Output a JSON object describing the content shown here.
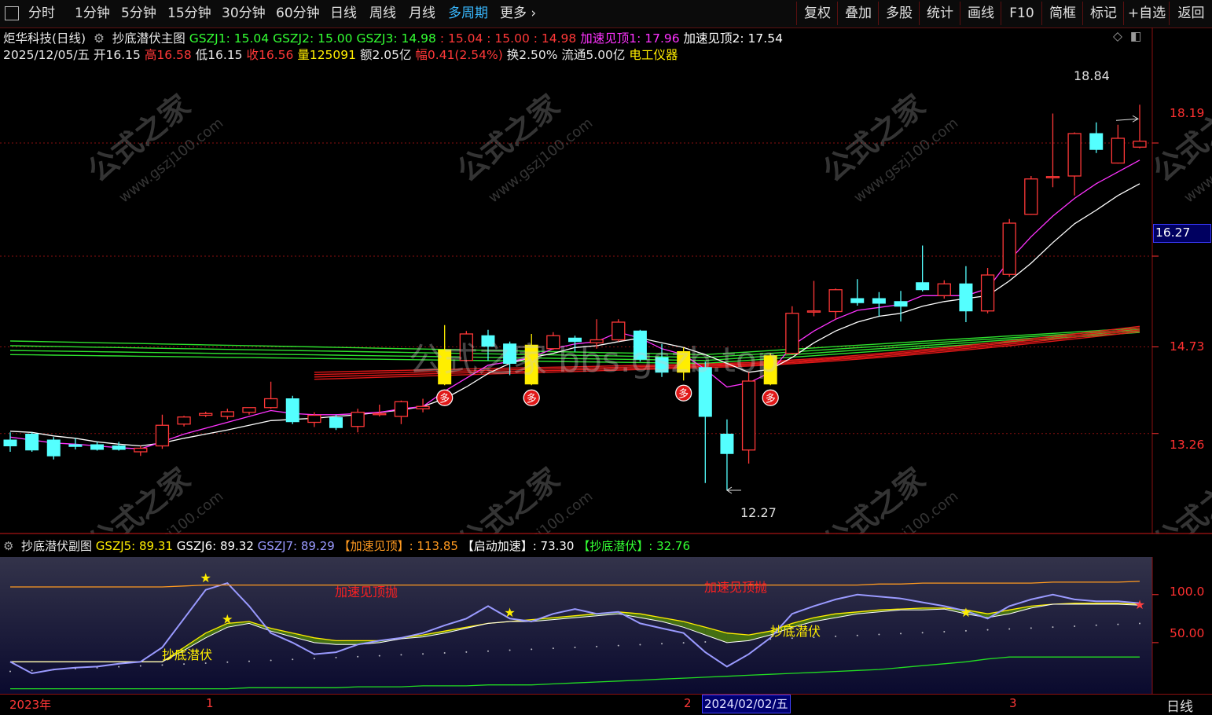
{
  "toolbar": {
    "periods": [
      "分时",
      "1分钟",
      "5分钟",
      "15分钟",
      "30分钟",
      "60分钟",
      "日线",
      "周线",
      "月线",
      "多周期",
      "更多"
    ],
    "active_period": "多周期",
    "actions": [
      "复权",
      "叠加",
      "多股",
      "统计",
      "画线",
      "F10",
      "简框",
      "标记",
      "+自选",
      "返回"
    ]
  },
  "main_header": {
    "stock": "炬华科技(日线)",
    "indicator": "抄底潜伏主图",
    "gszj1": "GSZJ1: 15.04",
    "gszj2": "GSZJ2: 15.00",
    "gszj3": "GSZJ3: 14.98",
    "v1": ": 15.04",
    "v2": ": 15.00",
    "v3": ": 14.98",
    "top1": "加速见顶1: 17.96",
    "top2": "加速见顶2: 17.54"
  },
  "quote": {
    "date": "2025/12/05/五",
    "open_label": "开",
    "open": "16.15",
    "high_label": "高",
    "high": "16.58",
    "low_label": "低",
    "low": "16.15",
    "close_label": "收",
    "close": "16.56",
    "vol_label": "量",
    "vol": "125091",
    "amount_label": "额",
    "amount": "2.05亿",
    "change_label": "幅",
    "change": "0.41(2.54%)",
    "turnover": "换2.50%",
    "float": "流通5.00亿",
    "sector": "电工仪器"
  },
  "price_axis": {
    "p1": "18.19",
    "p2": "16.27",
    "p3": "14.73",
    "p4": "13.26"
  },
  "annotations": {
    "max": "18.84",
    "min": "12.27",
    "duo": "多",
    "watermark_center": "公式之家 bbs.gszb.top",
    "watermark_tile": "公式之家",
    "watermark_url": "www.gszj100.com"
  },
  "sub_header": {
    "indicator": "抄底潜伏副图",
    "gszj5": "GSZJ5: 89.31",
    "gszj6": "GSZJ6: 89.32",
    "gszj7": "GSZJ7: 89.29",
    "accel_top": "【加速见顶】: 113.85",
    "start_accel": "【启动加速】: 73.30",
    "bottom": "【抄底潜伏】: 32.76"
  },
  "sub_axis": {
    "a1": "100.0",
    "a2": "50.00"
  },
  "sub_labels": {
    "l1": "加速见顶抛",
    "l2": "加速见顶抛",
    "l3": "抄底潜伏",
    "l4": "抄底潜伏"
  },
  "bottom_axis": {
    "year": "2023年",
    "m1": "1",
    "m2": "2",
    "cursor_date": "2024/02/02/五",
    "m3": "3",
    "period": "日线"
  },
  "colors": {
    "up": "#ff3838",
    "down": "#54ffff",
    "signal": "#ffee00",
    "ma_fast": "#ff33ff",
    "ma_slow": "#ffffff"
  },
  "chart_data": {
    "type": "candlestick",
    "price_range": [
      11.75,
      19.35
    ],
    "candles": [
      {
        "o": 13.15,
        "h": 13.28,
        "l": 12.95,
        "c": 13.05
      },
      {
        "o": 13.25,
        "h": 13.28,
        "l": 12.95,
        "c": 12.98
      },
      {
        "o": 13.15,
        "h": 13.2,
        "l": 12.82,
        "c": 12.88
      },
      {
        "o": 13.07,
        "h": 13.18,
        "l": 12.99,
        "c": 13.04
      },
      {
        "o": 13.07,
        "h": 13.12,
        "l": 12.97,
        "c": 12.99
      },
      {
        "o": 13.05,
        "h": 13.12,
        "l": 12.97,
        "c": 12.99
      },
      {
        "o": 12.95,
        "h": 13.05,
        "l": 12.88,
        "c": 13.01
      },
      {
        "o": 13.05,
        "h": 13.58,
        "l": 13.0,
        "c": 13.4
      },
      {
        "o": 13.42,
        "h": 13.56,
        "l": 13.38,
        "c": 13.54
      },
      {
        "o": 13.57,
        "h": 13.63,
        "l": 13.54,
        "c": 13.6
      },
      {
        "o": 13.55,
        "h": 13.68,
        "l": 13.5,
        "c": 13.63
      },
      {
        "o": 13.62,
        "h": 13.7,
        "l": 13.58,
        "c": 13.7
      },
      {
        "o": 13.7,
        "h": 14.14,
        "l": 13.68,
        "c": 13.85
      },
      {
        "o": 13.85,
        "h": 13.9,
        "l": 13.42,
        "c": 13.46
      },
      {
        "o": 13.45,
        "h": 13.62,
        "l": 13.37,
        "c": 13.57
      },
      {
        "o": 13.53,
        "h": 13.58,
        "l": 13.32,
        "c": 13.36
      },
      {
        "o": 13.38,
        "h": 13.68,
        "l": 13.28,
        "c": 13.62
      },
      {
        "o": 13.59,
        "h": 13.75,
        "l": 13.55,
        "c": 13.6
      },
      {
        "o": 13.55,
        "h": 13.82,
        "l": 13.42,
        "c": 13.8
      },
      {
        "o": 13.68,
        "h": 13.85,
        "l": 13.62,
        "c": 13.72
      },
      {
        "o": 14.1,
        "h": 15.1,
        "l": 14.08,
        "c": 14.68
      },
      {
        "o": 14.5,
        "h": 15.0,
        "l": 14.48,
        "c": 14.95
      },
      {
        "o": 14.92,
        "h": 15.02,
        "l": 14.5,
        "c": 14.74
      },
      {
        "o": 14.78,
        "h": 14.82,
        "l": 14.25,
        "c": 14.45
      },
      {
        "o": 14.1,
        "h": 14.95,
        "l": 14.08,
        "c": 14.76
      },
      {
        "o": 14.7,
        "h": 14.98,
        "l": 14.68,
        "c": 14.92
      },
      {
        "o": 14.88,
        "h": 14.92,
        "l": 14.65,
        "c": 14.82
      },
      {
        "o": 14.8,
        "h": 15.2,
        "l": 14.7,
        "c": 14.85
      },
      {
        "o": 14.85,
        "h": 15.2,
        "l": 14.82,
        "c": 15.15
      },
      {
        "o": 15.0,
        "h": 15.02,
        "l": 14.48,
        "c": 14.52
      },
      {
        "o": 14.55,
        "h": 14.78,
        "l": 14.22,
        "c": 14.3
      },
      {
        "o": 14.3,
        "h": 14.72,
        "l": 14.16,
        "c": 14.65
      },
      {
        "o": 14.38,
        "h": 14.48,
        "l": 12.42,
        "c": 13.55
      },
      {
        "o": 13.25,
        "h": 13.5,
        "l": 12.3,
        "c": 12.92
      },
      {
        "o": 12.98,
        "h": 14.3,
        "l": 12.75,
        "c": 14.15
      },
      {
        "o": 14.1,
        "h": 14.62,
        "l": 14.08,
        "c": 14.58
      },
      {
        "o": 14.62,
        "h": 15.42,
        "l": 14.6,
        "c": 15.3
      },
      {
        "o": 15.32,
        "h": 15.85,
        "l": 15.25,
        "c": 15.34
      },
      {
        "o": 15.33,
        "h": 15.72,
        "l": 15.2,
        "c": 15.7
      },
      {
        "o": 15.55,
        "h": 15.88,
        "l": 15.43,
        "c": 15.48
      },
      {
        "o": 15.55,
        "h": 15.66,
        "l": 15.25,
        "c": 15.47
      },
      {
        "o": 15.5,
        "h": 15.68,
        "l": 15.16,
        "c": 15.42
      },
      {
        "o": 15.82,
        "h": 16.45,
        "l": 15.67,
        "c": 15.7
      },
      {
        "o": 15.6,
        "h": 15.86,
        "l": 15.55,
        "c": 15.8
      },
      {
        "o": 15.8,
        "h": 16.1,
        "l": 15.15,
        "c": 15.34
      },
      {
        "o": 15.34,
        "h": 16.07,
        "l": 15.3,
        "c": 15.95
      },
      {
        "o": 15.96,
        "h": 16.9,
        "l": 15.92,
        "c": 16.83
      },
      {
        "o": 16.98,
        "h": 17.63,
        "l": 16.97,
        "c": 17.58
      },
      {
        "o": 17.6,
        "h": 18.69,
        "l": 17.44,
        "c": 17.62
      },
      {
        "o": 17.63,
        "h": 18.37,
        "l": 17.3,
        "c": 18.35
      },
      {
        "o": 18.35,
        "h": 18.54,
        "l": 18.02,
        "c": 18.08
      },
      {
        "o": 17.85,
        "h": 18.5,
        "l": 17.84,
        "c": 18.27
      },
      {
        "o": 18.12,
        "h": 18.84,
        "l": 18.1,
        "c": 18.22
      }
    ],
    "signal_candles": [
      20,
      24,
      31,
      35
    ],
    "ma_fast": [
      13.2,
      13.15,
      13.1,
      13.08,
      13.05,
      13.02,
      13.0,
      13.12,
      13.25,
      13.35,
      13.45,
      13.55,
      13.65,
      13.6,
      13.58,
      13.58,
      13.6,
      13.62,
      13.68,
      13.72,
      13.98,
      14.2,
      14.42,
      14.48,
      14.55,
      14.7,
      14.78,
      14.82,
      14.98,
      14.88,
      14.7,
      14.6,
      14.35,
      14.05,
      14.12,
      14.3,
      14.75,
      15.0,
      15.2,
      15.35,
      15.4,
      15.45,
      15.6,
      15.6,
      15.6,
      15.72,
      16.2,
      16.6,
      16.95,
      17.25,
      17.5,
      17.7,
      17.9
    ],
    "ma_slow": [
      13.3,
      13.28,
      13.22,
      13.18,
      13.12,
      13.08,
      13.05,
      13.1,
      13.18,
      13.25,
      13.32,
      13.4,
      13.48,
      13.5,
      13.52,
      13.55,
      13.58,
      13.62,
      13.66,
      13.72,
      13.85,
      14.05,
      14.28,
      14.45,
      14.55,
      14.62,
      14.72,
      14.75,
      14.82,
      14.88,
      14.8,
      14.72,
      14.6,
      14.45,
      14.3,
      14.35,
      14.55,
      14.8,
      15.0,
      15.15,
      15.25,
      15.3,
      15.42,
      15.5,
      15.55,
      15.6,
      15.85,
      16.15,
      16.5,
      16.82,
      17.05,
      17.3,
      17.5
    ],
    "sub_range": [
      0,
      135
    ],
    "gszj_fast": [
      30,
      18,
      22,
      24,
      25,
      28,
      30,
      45,
      75,
      105,
      112,
      88,
      60,
      50,
      38,
      40,
      48,
      52,
      55,
      60,
      68,
      75,
      88,
      75,
      72,
      80,
      85,
      80,
      82,
      70,
      65,
      60,
      40,
      25,
      38,
      55,
      80,
      88,
      95,
      100,
      98,
      96,
      92,
      88,
      83,
      75,
      88,
      95,
      100,
      95,
      93,
      93,
      91
    ],
    "gszj_slow": [
      30,
      30,
      30,
      30,
      30,
      30,
      30,
      30,
      45,
      60,
      70,
      72,
      65,
      60,
      55,
      52,
      52,
      52,
      55,
      58,
      62,
      66,
      70,
      72,
      74,
      76,
      78,
      80,
      82,
      80,
      76,
      72,
      66,
      60,
      58,
      62,
      70,
      76,
      80,
      82,
      84,
      85,
      86,
      86,
      84,
      80,
      84,
      88,
      90,
      91,
      91,
      91,
      90
    ],
    "gszj_line2": [
      30,
      30,
      30,
      30,
      30,
      30,
      30,
      30,
      42,
      55,
      66,
      70,
      62,
      56,
      50,
      48,
      48,
      50,
      54,
      56,
      60,
      65,
      70,
      72,
      72,
      74,
      76,
      78,
      80,
      76,
      72,
      66,
      58,
      50,
      52,
      58,
      66,
      72,
      76,
      80,
      82,
      84,
      84,
      85,
      80,
      76,
      80,
      86,
      90,
      90,
      90,
      90,
      89
    ],
    "accel_top_line": [
      108,
      108,
      108,
      108,
      108,
      108,
      108,
      108,
      109,
      110,
      110,
      110,
      110,
      110,
      110,
      110,
      110,
      110,
      110,
      110,
      110,
      110,
      110,
      110,
      110,
      110,
      110,
      110,
      110,
      110,
      110,
      110,
      110,
      110,
      110,
      110,
      110,
      110,
      110,
      110,
      111,
      111,
      112,
      112,
      112,
      112,
      112,
      112,
      113,
      113,
      113,
      113,
      113.85
    ],
    "bottom_line": [
      2,
      2,
      2,
      2,
      2,
      2,
      2,
      2,
      2,
      2,
      2,
      3,
      3,
      3,
      3,
      3,
      4,
      4,
      4,
      5,
      5,
      5,
      6,
      6,
      6,
      7,
      8,
      9,
      10,
      11,
      12,
      13,
      14,
      15,
      16,
      17,
      18,
      19,
      20,
      21,
      22,
      24,
      26,
      28,
      30,
      33,
      35,
      35,
      35,
      35,
      35,
      35,
      35
    ]
  }
}
